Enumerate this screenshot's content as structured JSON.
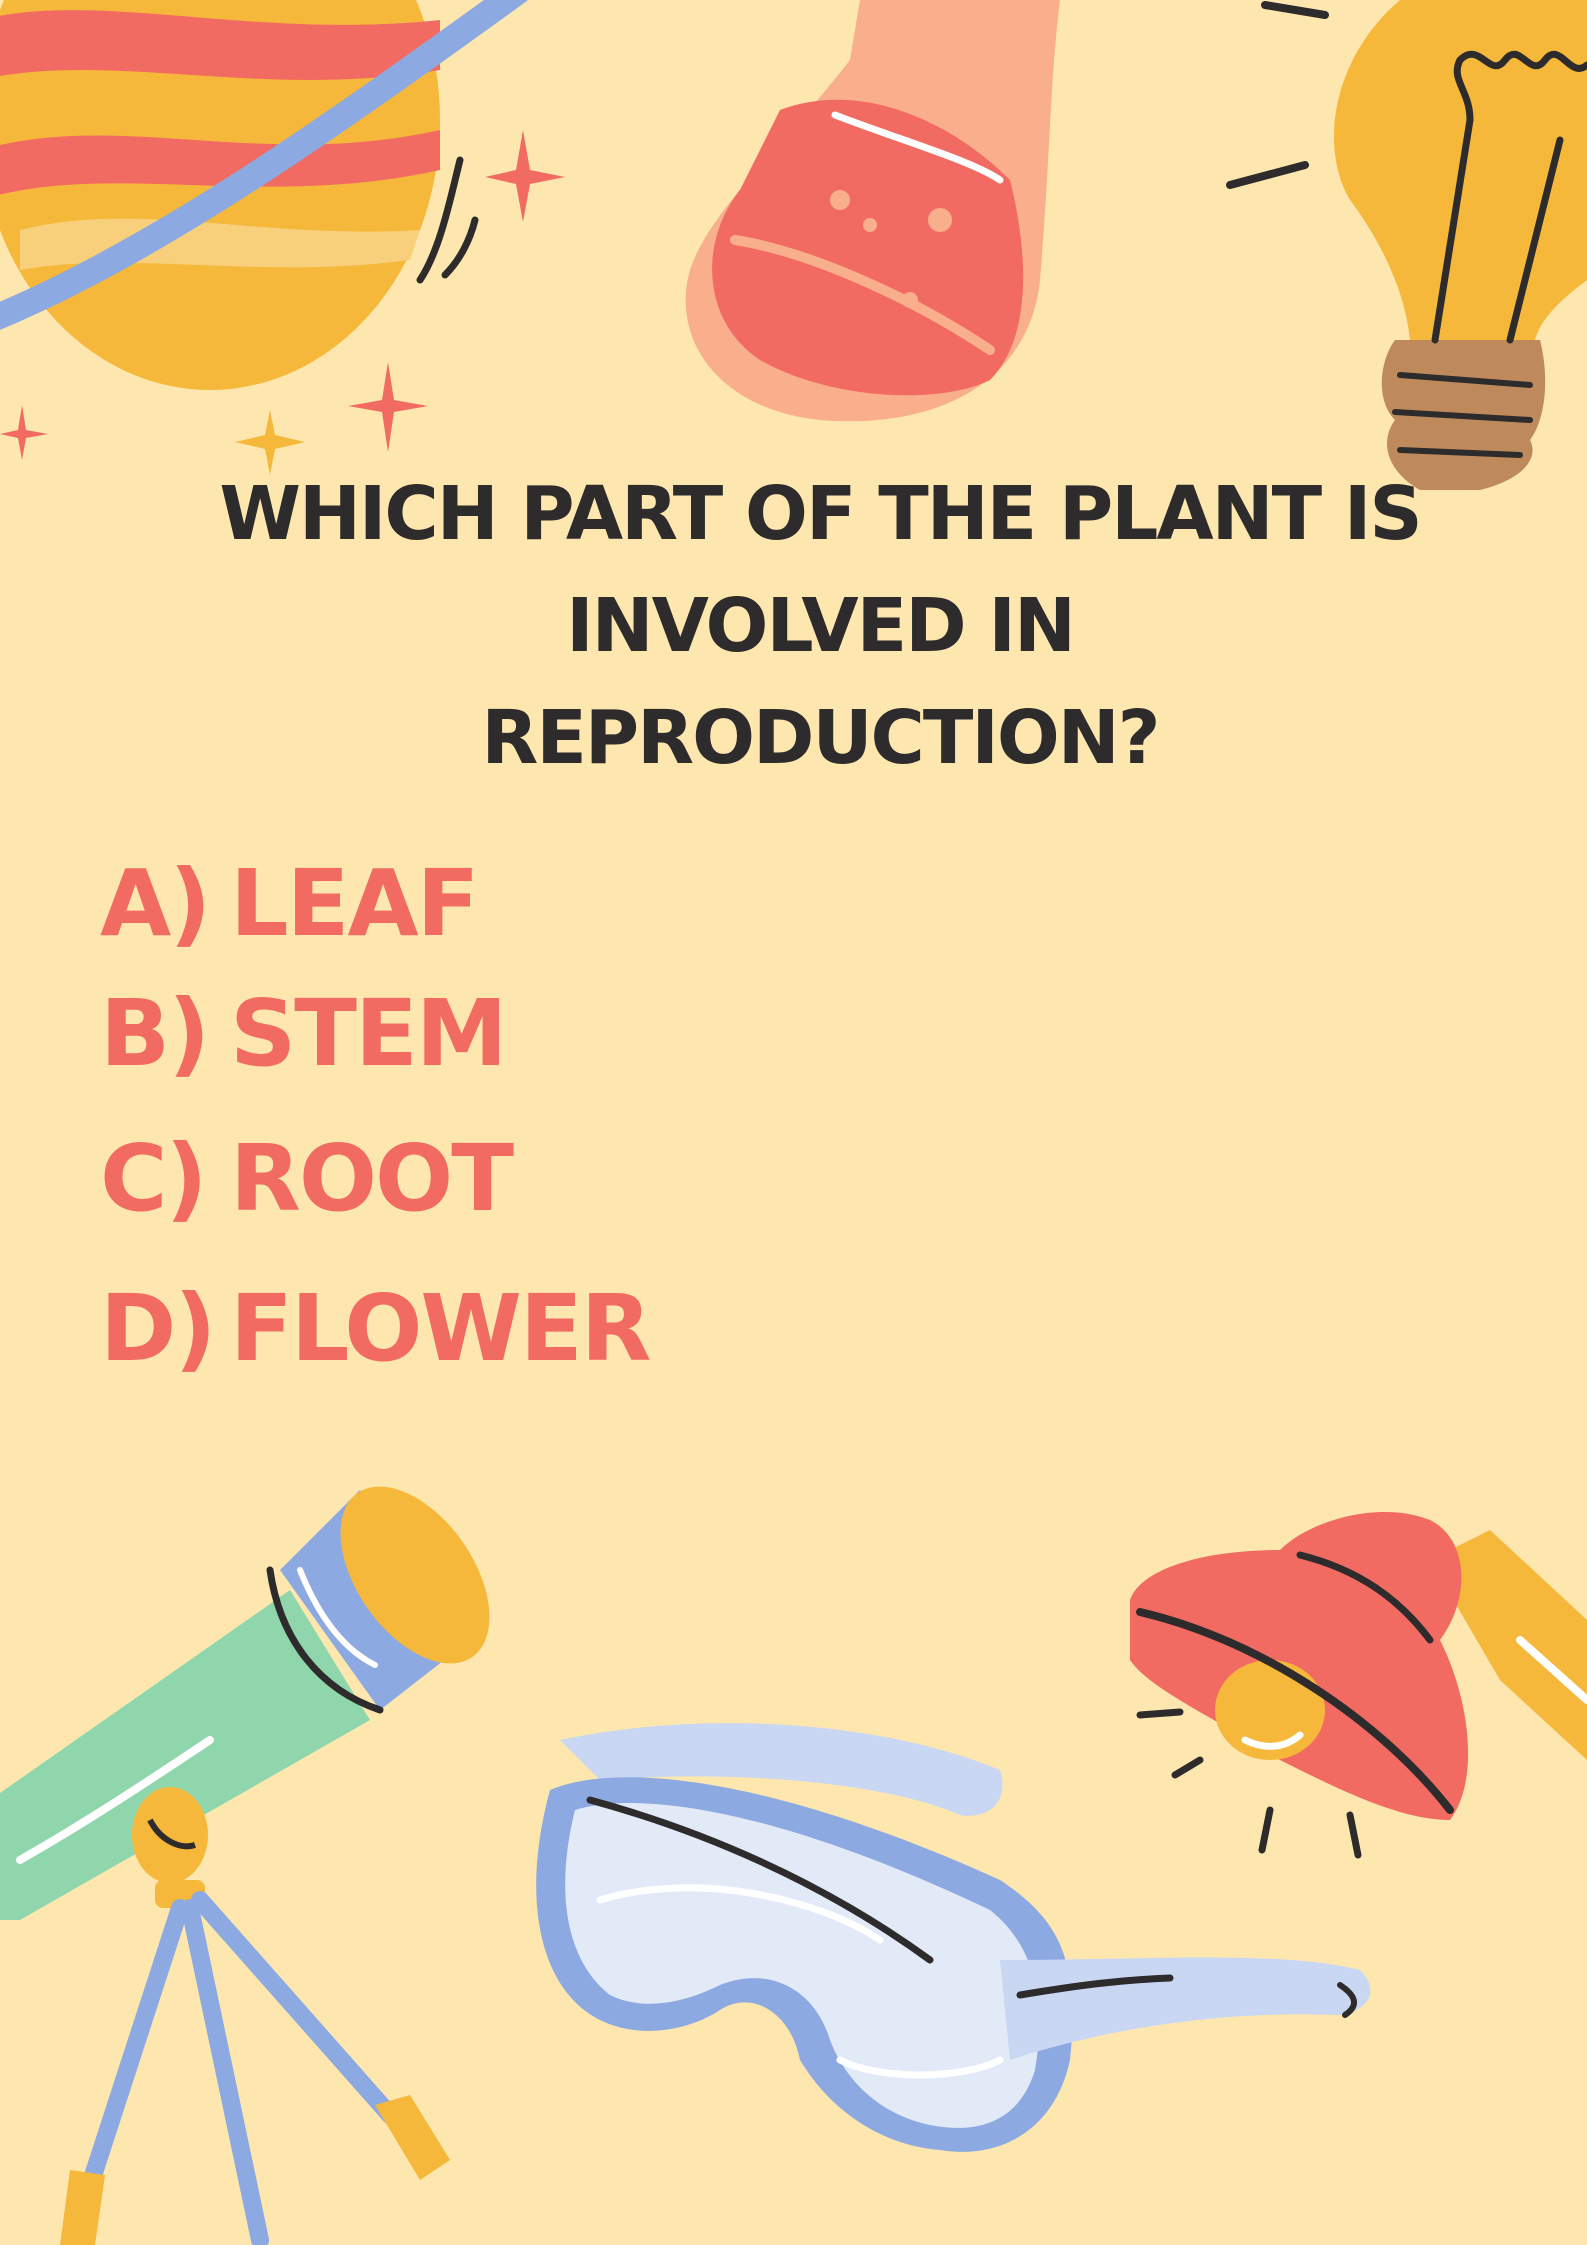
{
  "question": {
    "line1": "WHICH PART OF THE PLANT IS INVOLVED IN",
    "line2": "REPRODUCTION?"
  },
  "options": [
    {
      "label": "A)",
      "text": "LEAF"
    },
    {
      "label": "B)",
      "text": "STEM"
    },
    {
      "label": "C)",
      "text": "ROOT"
    },
    {
      "label": "D)",
      "text": "FLOWER"
    }
  ],
  "colors": {
    "background": "#FDE7AF",
    "question_text": "#2D2B2B",
    "option_text": "#F26B63",
    "accent_yellow": "#F5B83A",
    "accent_red": "#F26B63",
    "accent_blue": "#8DA9E1",
    "accent_green": "#8FD6AD"
  },
  "icons": [
    "planet-icon",
    "flask-icon",
    "light-bulb-icon",
    "telescope-icon",
    "safety-goggles-icon",
    "microscope-lamp-icon",
    "sparkle-icon"
  ]
}
